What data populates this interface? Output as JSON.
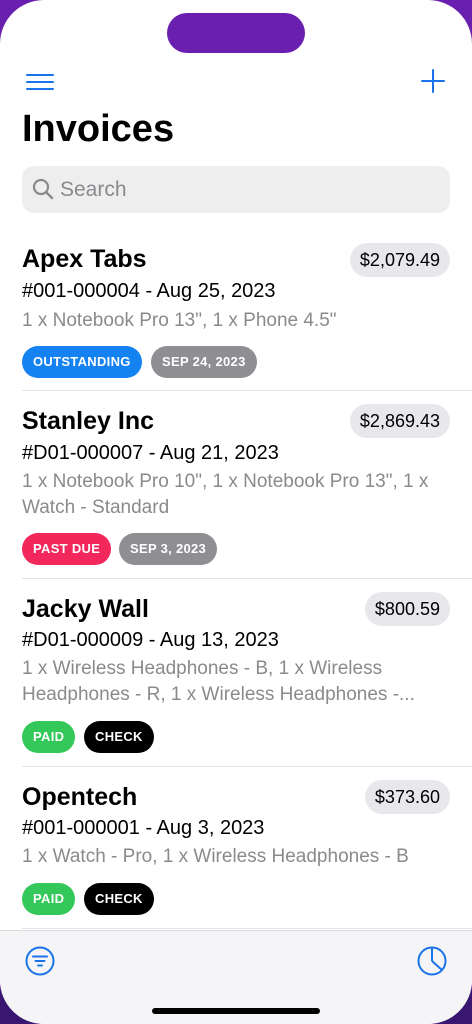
{
  "header": {
    "title": "Invoices",
    "menu_icon": "hamburger-icon",
    "add_icon": "plus-icon"
  },
  "search": {
    "placeholder": "Search",
    "value": ""
  },
  "invoices": [
    {
      "name": "Apex Tabs",
      "amount": "$2,079.49",
      "number": "#001-000004 - Aug 25, 2023",
      "items": "1 x Notebook Pro 13\", 1 x Phone 4.5\"",
      "status": "OUTSTANDING",
      "tag": "SEP 24, 2023"
    },
    {
      "name": "Stanley Inc",
      "amount": "$2,869.43",
      "number": "#D01-000007 - Aug 21, 2023",
      "items": "1 x Notebook Pro 10\", 1 x Notebook Pro 13\", 1 x Watch - Standard",
      "status": "PAST DUE",
      "tag": "SEP 3, 2023"
    },
    {
      "name": "Jacky Wall",
      "amount": "$800.59",
      "number": "#D01-000009 - Aug 13, 2023",
      "items": "1 x Wireless Headphones - B, 1 x Wireless Headphones - R, 1 x Wireless Headphones -...",
      "status": "PAID",
      "tag": "CHECK"
    },
    {
      "name": "Opentech",
      "amount": "$373.60",
      "number": "#001-000001 - Aug 3, 2023",
      "items": "1 x Watch - Pro, 1 x Wireless Headphones - B",
      "status": "PAID",
      "tag": "CHECK"
    }
  ],
  "tabbar": {
    "left_icon": "filter-icon",
    "right_icon": "pie-chart-icon"
  },
  "colors": {
    "accent": "#1a73e8",
    "outstanding": "#1482f0",
    "past_due": "#f2275c",
    "paid": "#34c759",
    "check": "#000000",
    "date_tag": "#8e8e93"
  }
}
